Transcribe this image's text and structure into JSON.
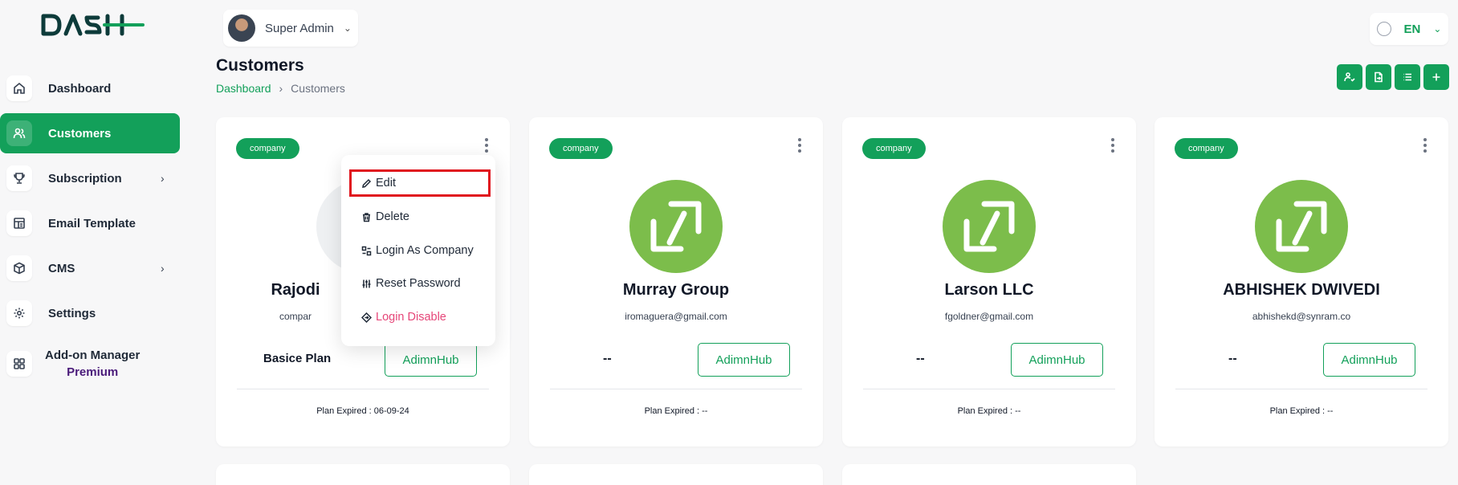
{
  "brand": {
    "logo_text": "DASH",
    "accent": "#13a05a"
  },
  "header": {
    "user_name": "Super Admin",
    "language": "EN",
    "page_title": "Customers",
    "breadcrumb": [
      "Dashboard",
      "Customers"
    ]
  },
  "sidebar": {
    "items": [
      {
        "label": "Dashboard",
        "icon": "home-icon",
        "active": false,
        "has_children": false
      },
      {
        "label": "Customers",
        "icon": "users-icon",
        "active": true,
        "has_children": false
      },
      {
        "label": "Subscription",
        "icon": "trophy-icon",
        "active": false,
        "has_children": true
      },
      {
        "label": "Email Template",
        "icon": "template-icon",
        "active": false,
        "has_children": false
      },
      {
        "label": "CMS",
        "icon": "cube-icon",
        "active": false,
        "has_children": true
      },
      {
        "label": "Settings",
        "icon": "gear-icon",
        "active": false,
        "has_children": false
      }
    ],
    "addon": {
      "label": "Add-on Manager",
      "badge": "Premium",
      "icon": "grid-icon"
    }
  },
  "toolbar": {
    "icons": [
      "user-check-icon",
      "file-export-icon",
      "list-view-icon",
      "plus-icon"
    ]
  },
  "customers": [
    {
      "type_badge": "company",
      "name": "Rajodi",
      "email": "compar",
      "plan": "Basice Plan",
      "hub_label": "AdimnHub",
      "expired": "Plan Expired : 06-09-24"
    },
    {
      "type_badge": "company",
      "name": "Murray Group",
      "email": "iromaguera@gmail.com",
      "plan": "--",
      "hub_label": "AdimnHub",
      "expired": "Plan Expired : --"
    },
    {
      "type_badge": "company",
      "name": "Larson LLC",
      "email": "fgoldner@gmail.com",
      "plan": "--",
      "hub_label": "AdimnHub",
      "expired": "Plan Expired : --"
    },
    {
      "type_badge": "company",
      "name": "ABHISHEK DWIVEDI",
      "email": "abhishekd@synram.co",
      "plan": "--",
      "hub_label": "AdimnHub",
      "expired": "Plan Expired : --"
    }
  ],
  "context_menu": {
    "items": [
      "Edit",
      "Delete",
      "Login As Company",
      "Reset Password",
      "Login Disable"
    ],
    "highlight_color": "#e0141e",
    "danger_color": "#e64578"
  }
}
